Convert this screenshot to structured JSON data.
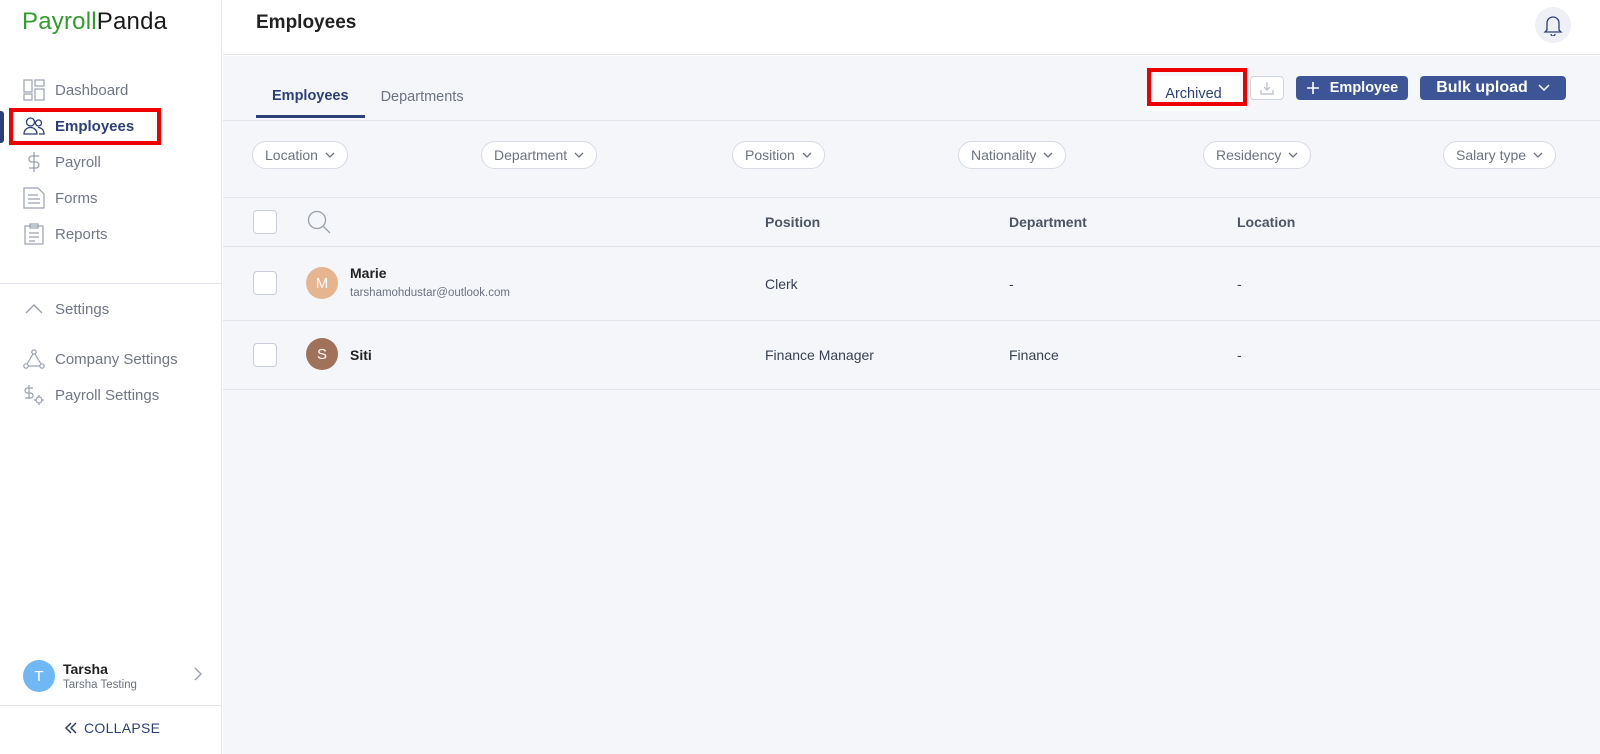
{
  "brand": {
    "part1": "Payroll",
    "part2": "Panda"
  },
  "sidebar": {
    "items": [
      {
        "label": "Dashboard",
        "icon": "dashboard-icon"
      },
      {
        "label": "Employees",
        "icon": "users-icon",
        "active": true
      },
      {
        "label": "Payroll",
        "icon": "dollar-icon"
      },
      {
        "label": "Forms",
        "icon": "document-icon"
      },
      {
        "label": "Reports",
        "icon": "clipboard-icon"
      }
    ],
    "settings_label": "Settings",
    "settings_items": [
      {
        "label": "Company Settings",
        "icon": "network-icon"
      },
      {
        "label": "Payroll Settings",
        "icon": "payroll-settings-icon"
      }
    ],
    "user": {
      "initial": "T",
      "name": "Tarsha",
      "company": "Tarsha Testing"
    },
    "collapse_label": "COLLAPSE"
  },
  "header": {
    "title": "Employees"
  },
  "tabs": [
    {
      "label": "Employees",
      "active": true
    },
    {
      "label": "Departments",
      "active": false
    }
  ],
  "toolbar": {
    "archived_label": "Archived",
    "add_employee_label": "Employee",
    "bulk_upload_label": "Bulk upload"
  },
  "filters": [
    "Location",
    "Department",
    "Position",
    "Nationality",
    "Residency",
    "Salary type"
  ],
  "table": {
    "columns": [
      "Position",
      "Department",
      "Location"
    ],
    "rows": [
      {
        "initial": "M",
        "name": "Marie",
        "email": "tarshamohdustar@outlook.com",
        "position": "Clerk",
        "department": "-",
        "location": "-",
        "avatar_color": "#e6b58f"
      },
      {
        "initial": "S",
        "name": "Siti",
        "email": "",
        "position": "Finance Manager",
        "department": "Finance",
        "location": "-",
        "avatar_color": "#a0725a"
      }
    ]
  },
  "colors": {
    "accent": "#2d3f78",
    "brand_green": "#2f9e2a",
    "button": "#3d5596",
    "highlight": "#ee0000"
  }
}
